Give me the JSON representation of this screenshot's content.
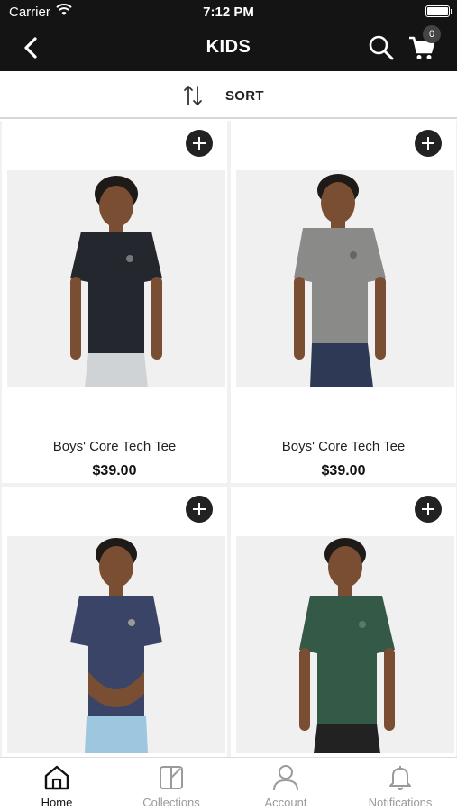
{
  "status_bar": {
    "carrier": "Carrier",
    "time": "7:12 PM"
  },
  "nav": {
    "title": "KIDS",
    "cart_count": "0"
  },
  "sort": {
    "label": "SORT"
  },
  "products": [
    {
      "name": "Boys' Core Tech Tee",
      "price": "$39.00",
      "shirt_color": "#24272d",
      "shorts_color": "#d0d3d6"
    },
    {
      "name": "Boys' Core Tech Tee",
      "price": "$39.00",
      "shirt_color": "#8a8a88",
      "shorts_color": "#2e3a55"
    },
    {
      "name": "",
      "price": "",
      "shirt_color": "#3a4466",
      "shorts_color": "#9cc7de"
    },
    {
      "name": "",
      "price": "",
      "shirt_color": "#345a47",
      "shorts_color": "#222222"
    }
  ],
  "tabs": [
    {
      "label": "Home",
      "icon": "home-icon",
      "active": true
    },
    {
      "label": "Collections",
      "icon": "collections-icon",
      "active": false
    },
    {
      "label": "Account",
      "icon": "account-icon",
      "active": false
    },
    {
      "label": "Notifications",
      "icon": "bell-icon",
      "active": false
    }
  ],
  "colors": {
    "header_bg": "#141414",
    "accent": "#222222",
    "tab_inactive": "#9a9a9a"
  }
}
